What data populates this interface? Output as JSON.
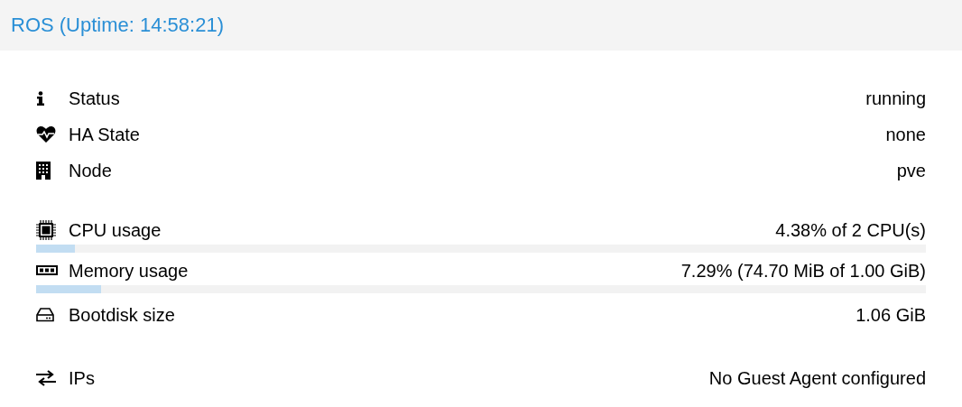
{
  "panel": {
    "title": "ROS (Uptime: 14:58:21)"
  },
  "groups": [
    {
      "rows": [
        {
          "kind": "info",
          "label": "Status",
          "value": "running"
        },
        {
          "kind": "info",
          "label": "HA State",
          "value": "none"
        },
        {
          "kind": "info",
          "label": "Node",
          "value": "pve"
        }
      ]
    },
    {
      "rows": [
        {
          "kind": "meter",
          "label": "CPU usage",
          "value": "4.38% of 2 CPU(s)",
          "level": 0.0438
        },
        {
          "kind": "meter",
          "label": "Memory usage",
          "value": "7.29% (74.70 MiB of 1.00 GiB)",
          "level": 0.0729
        },
        {
          "kind": "info",
          "label": "Bootdisk size",
          "value": "1.06 GiB"
        }
      ]
    },
    {
      "rows": [
        {
          "kind": "info",
          "label": "IPs",
          "value": "No Guest Agent configured"
        }
      ]
    }
  ]
}
